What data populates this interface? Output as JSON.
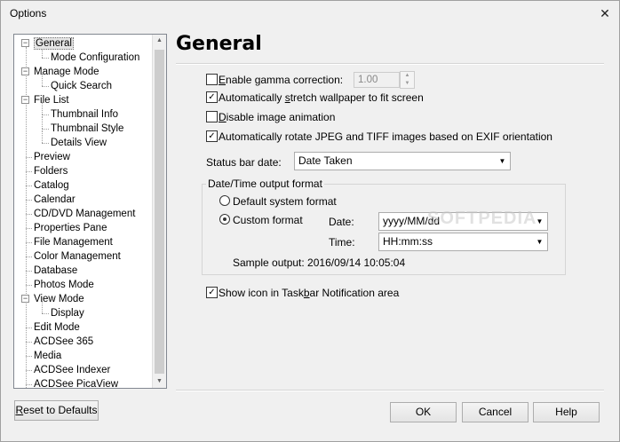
{
  "window": {
    "title": "Options",
    "close_glyph": "✕"
  },
  "tree": {
    "items": [
      {
        "label": "General",
        "level": 0,
        "expander": "−",
        "selected": true
      },
      {
        "label": "Mode Configuration",
        "level": 1
      },
      {
        "label": "Manage Mode",
        "level": 0,
        "expander": "−"
      },
      {
        "label": "Quick Search",
        "level": 1
      },
      {
        "label": "File List",
        "level": 0,
        "expander": "−"
      },
      {
        "label": "Thumbnail Info",
        "level": 1
      },
      {
        "label": "Thumbnail Style",
        "level": 1
      },
      {
        "label": "Details View",
        "level": 1
      },
      {
        "label": "Preview",
        "level": 0
      },
      {
        "label": "Folders",
        "level": 0
      },
      {
        "label": "Catalog",
        "level": 0
      },
      {
        "label": "Calendar",
        "level": 0
      },
      {
        "label": "CD/DVD Management",
        "level": 0
      },
      {
        "label": "Properties Pane",
        "level": 0
      },
      {
        "label": "File Management",
        "level": 0
      },
      {
        "label": "Color Management",
        "level": 0
      },
      {
        "label": "Database",
        "level": 0
      },
      {
        "label": "Photos Mode",
        "level": 0
      },
      {
        "label": "View Mode",
        "level": 0,
        "expander": "−"
      },
      {
        "label": "Display",
        "level": 1
      },
      {
        "label": "Edit Mode",
        "level": 0
      },
      {
        "label": "ACDSee 365",
        "level": 0
      },
      {
        "label": "Media",
        "level": 0
      },
      {
        "label": "ACDSee Indexer",
        "level": 0
      },
      {
        "label": "ACDSee PicaView",
        "level": 0
      }
    ]
  },
  "buttons": {
    "reset_prefix": "",
    "reset_accel": "R",
    "reset_rest": "eset to Defaults",
    "ok": "OK",
    "cancel": "Cancel",
    "help": "Help"
  },
  "general": {
    "title": "General",
    "gamma": {
      "accel": "E",
      "rest": "nable gamma correction:",
      "checked": false,
      "value": "1.00"
    },
    "stretch": {
      "pre": "Automatically ",
      "accel": "s",
      "rest": "tretch wallpaper to fit screen",
      "checked": true
    },
    "disable_anim": {
      "accel": "D",
      "rest": "isable image animation",
      "checked": false
    },
    "auto_rotate": {
      "label": "Automatically rotate JPEG and TIFF images based on EXIF orientation",
      "checked": true
    },
    "status_bar": {
      "label": "Status bar date:",
      "value": "Date Taken"
    },
    "datetime_group": {
      "title": "Date/Time output format",
      "default_label": "Default system format",
      "custom_label": "Custom format",
      "selected": "custom",
      "date_label": "Date:",
      "date_value": "yyyy/MM/dd",
      "time_label": "Time:",
      "time_value": "HH:mm:ss",
      "sample": "Sample output: 2016/09/14 10:05:04"
    },
    "taskbar": {
      "pre": "Show icon in Task",
      "accel": "b",
      "rest": "ar Notification area",
      "checked": true
    }
  },
  "watermark": "SOFTPEDIA"
}
